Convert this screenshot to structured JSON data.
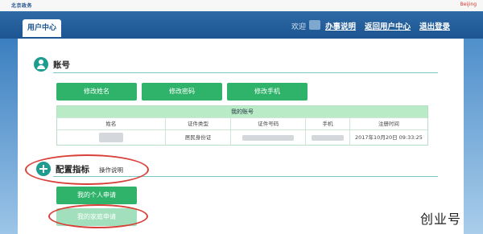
{
  "header": {
    "logo_text": "北京政务",
    "brand_right": "Beijing",
    "nav_title": "用户中心",
    "welcome": "欢迎",
    "links": [
      "办事说明",
      "返回用户中心",
      "退出登录"
    ]
  },
  "account": {
    "title": "账号",
    "buttons": [
      "修改姓名",
      "修改密码",
      "修改手机"
    ],
    "table": {
      "caption": "我的账号",
      "headers": [
        "姓名",
        "证件类型",
        "证件号码",
        "手机",
        "注册时间"
      ],
      "row": {
        "id_type": "居民身份证",
        "register_time": "2017年10月20日 09:33:25"
      }
    }
  },
  "config": {
    "title": "配置指标",
    "help": "操作说明",
    "buttons": [
      "我的个人申请",
      "我的家庭申请"
    ]
  },
  "watermark": "创业号",
  "colors": {
    "nav_blue": "#1c5591",
    "button_green": "#2fb36a",
    "table_header_green": "#b9ecc6",
    "annotation_red": "#d8413a"
  }
}
